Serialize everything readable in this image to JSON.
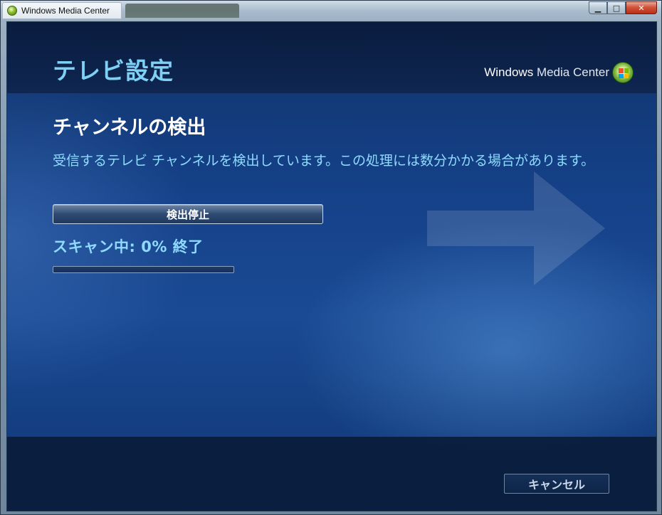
{
  "window": {
    "title": "Windows Media Center",
    "caption": {
      "minimize": "▁",
      "maximize": "□",
      "close": "✕"
    }
  },
  "header": {
    "title": "テレビ設定",
    "brand_primary": "Windows",
    "brand_secondary": "Media Center",
    "brand_icon": "windows-orb-icon"
  },
  "main": {
    "section_title": "チャンネルの検出",
    "description": "受信するテレビ チャンネルを検出しています。この処理には数分かかる場合があります。",
    "stop_button_label": "検出停止",
    "scan_status": "スキャン中: 0% 終了",
    "progress_percent": 0
  },
  "footer": {
    "cancel_label": "キャンセル"
  },
  "colors": {
    "accent": "#8fdaff",
    "title": "#7fd0f5",
    "background": "#154189"
  }
}
